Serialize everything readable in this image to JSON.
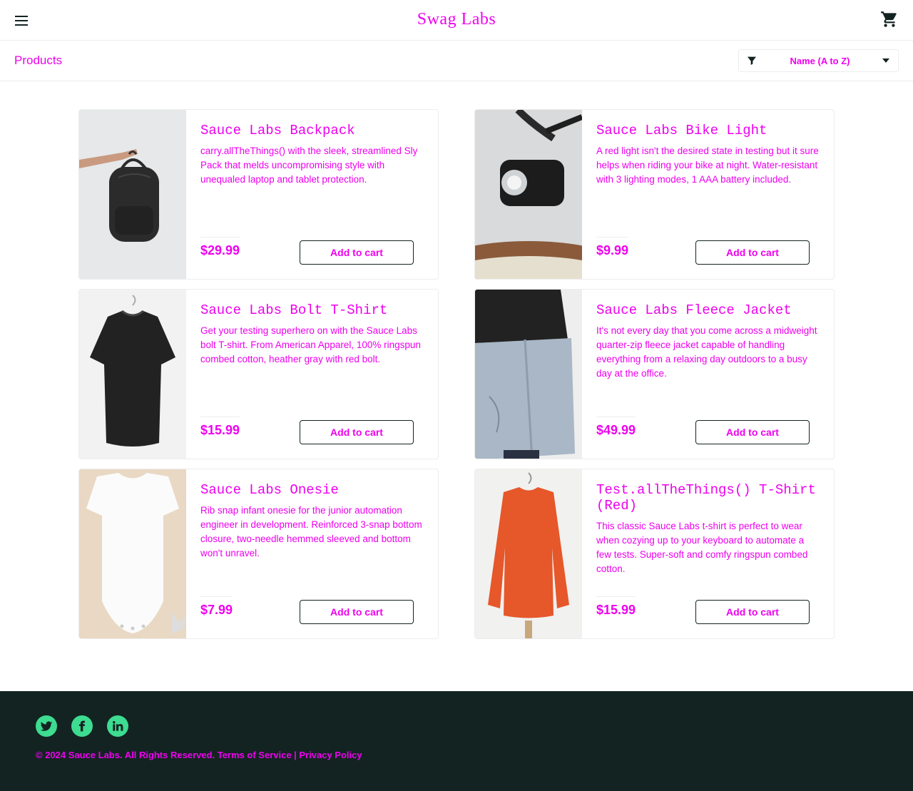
{
  "header": {
    "logo": "Swag Labs",
    "menu_icon": "menu-icon",
    "cart_icon": "cart-icon"
  },
  "subheader": {
    "title": "Products",
    "sort": {
      "selected": "Name (A to Z)",
      "filter_icon": "filter-icon"
    }
  },
  "products": [
    {
      "name": "Sauce Labs Backpack",
      "description": "carry.allTheThings() with the sleek, streamlined Sly Pack that melds uncompromising style with unequaled laptop and tablet protection.",
      "price": "$29.99",
      "button": "Add to cart",
      "image": "backpack-image"
    },
    {
      "name": "Sauce Labs Bike Light",
      "description": "A red light isn't the desired state in testing but it sure helps when riding your bike at night. Water-resistant with 3 lighting modes, 1 AAA battery included.",
      "price": "$9.99",
      "button": "Add to cart",
      "image": "bike-light-image"
    },
    {
      "name": "Sauce Labs Bolt T-Shirt",
      "description": "Get your testing superhero on with the Sauce Labs bolt T-shirt. From American Apparel, 100% ringspun combed cotton, heather gray with red bolt.",
      "price": "$15.99",
      "button": "Add to cart",
      "image": "bolt-tshirt-image"
    },
    {
      "name": "Sauce Labs Fleece Jacket",
      "description": "It's not every day that you come across a midweight quarter-zip fleece jacket capable of handling everything from a relaxing day outdoors to a busy day at the office.",
      "price": "$49.99",
      "button": "Add to cart",
      "image": "fleece-jacket-image"
    },
    {
      "name": "Sauce Labs Onesie",
      "description": "Rib snap infant onesie for the junior automation engineer in development. Reinforced 3-snap bottom closure, two-needle hemmed sleeved and bottom won't unravel.",
      "price": "$7.99",
      "button": "Add to cart",
      "image": "onesie-image"
    },
    {
      "name": "Test.allTheThings() T-Shirt (Red)",
      "description": "This classic Sauce Labs t-shirt is perfect to wear when cozying up to your keyboard to automate a few tests. Super-soft and comfy ringspun combed cotton.",
      "price": "$15.99",
      "button": "Add to cart",
      "image": "red-tshirt-image"
    }
  ],
  "footer": {
    "social": [
      "twitter-icon",
      "facebook-icon",
      "linkedin-icon"
    ],
    "copyright": "© 2024 Sauce Labs. All Rights Reserved. Terms of Service | Privacy Policy"
  },
  "colors": {
    "accent_text": "#ee00ee",
    "footer_bg": "#132322",
    "social_green": "#3ddc91"
  }
}
